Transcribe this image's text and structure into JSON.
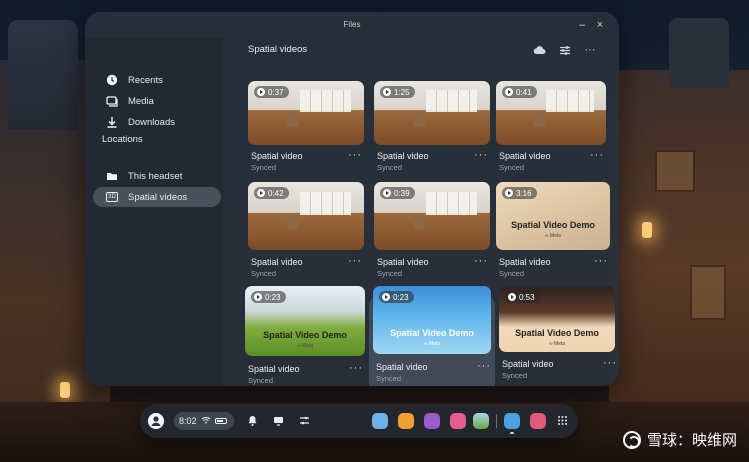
{
  "window": {
    "title": "Files",
    "minimize_glyph": "–",
    "close_glyph": "×"
  },
  "sidebar": {
    "items": [
      {
        "label": "Recents",
        "icon": "clock-icon"
      },
      {
        "label": "Media",
        "icon": "media-icon"
      },
      {
        "label": "Downloads",
        "icon": "download-icon"
      }
    ],
    "locations_heading": "Locations",
    "locations": [
      {
        "label": "This headset",
        "icon": "folder-icon"
      },
      {
        "label": "Spatial videos",
        "icon": "3d-badge-icon",
        "badge": "3D",
        "selected": true
      }
    ]
  },
  "main": {
    "section_title": "Spatial videos",
    "actions": [
      "cloud-icon",
      "filter-icon",
      "more-icon"
    ],
    "more_glyph": "···",
    "tiles": [
      {
        "duration": "0:37",
        "name": "Spatial video",
        "status": "Synced",
        "kind": "room"
      },
      {
        "duration": "1:25",
        "name": "Spatial video",
        "status": "Synced",
        "kind": "room"
      },
      {
        "duration": "0:41",
        "name": "Spatial video",
        "status": "Synced",
        "kind": "room"
      },
      {
        "duration": "0:42",
        "name": "Spatial video",
        "status": "Synced",
        "kind": "room"
      },
      {
        "duration": "0:39",
        "name": "Spatial video",
        "status": "Synced",
        "kind": "room"
      },
      {
        "duration": "3:16",
        "name": "Spatial video",
        "status": "Synced",
        "kind": "demo",
        "overlay": "Spatial Video Demo",
        "logo": "∞ Meta"
      },
      {
        "duration": "0:23",
        "name": "Spatial video",
        "status": "Synced",
        "kind": "dog",
        "overlay": "Spatial Video Demo",
        "logo": "∞ Meta"
      },
      {
        "duration": "0:23",
        "name": "Spatial video",
        "status": "Synced",
        "kind": "fish",
        "overlay": "Spatial Video Demo",
        "logo": "∞ Meta",
        "selected": true
      },
      {
        "duration": "0:53",
        "name": "Spatial video",
        "status": "Synced",
        "kind": "stage",
        "overlay": "Spatial Video Demo",
        "logo": "∞ Meta"
      }
    ]
  },
  "taskbar": {
    "time": "8:02",
    "apps": [
      "gallery-app-icon",
      "store-app-icon",
      "people-app-icon",
      "camera-app-icon",
      "explore-app-icon",
      "files-app-icon",
      "game-app-icon",
      "app-library-icon"
    ]
  },
  "watermark": {
    "text": "雪球：映维网"
  }
}
